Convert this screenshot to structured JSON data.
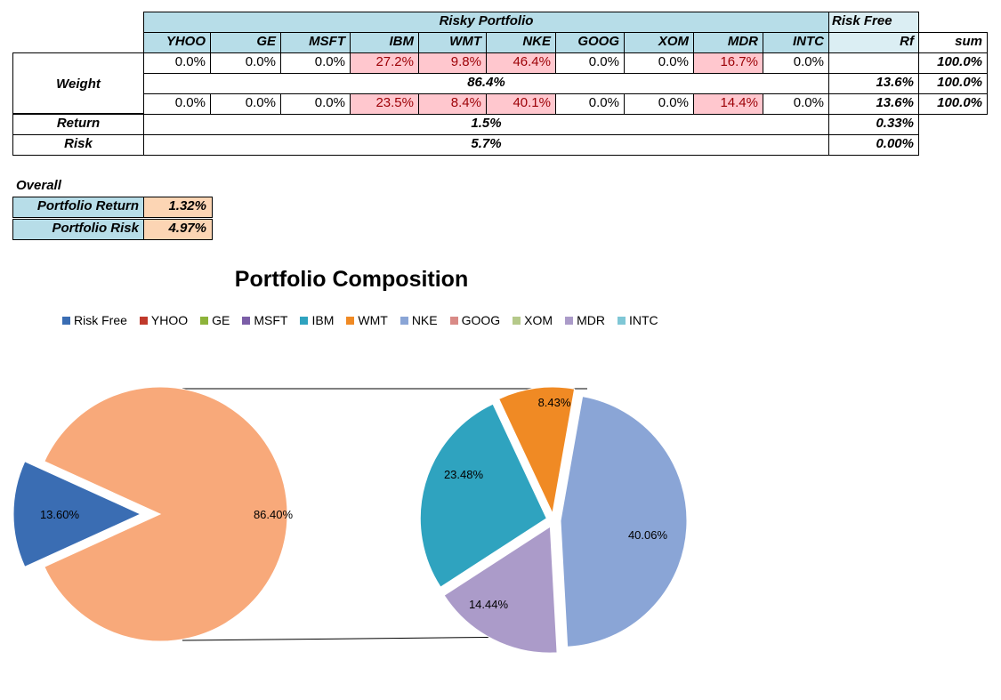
{
  "table": {
    "risky_header": "Risky Portfolio",
    "riskfree_header": "Risk Free",
    "columns": [
      "YHOO",
      "GE",
      "MSFT",
      "IBM",
      "WMT",
      "NKE",
      "GOOG",
      "XOM",
      "MDR",
      "INTC"
    ],
    "rf_col": "Rf",
    "sum_col": "sum",
    "weight_label": "Weight",
    "row1": [
      "0.0%",
      "0.0%",
      "0.0%",
      "27.2%",
      "9.8%",
      "46.4%",
      "0.0%",
      "0.0%",
      "16.7%",
      "0.0%"
    ],
    "row1_sum": "100.0%",
    "row2_risky": "86.4%",
    "row2_rf": "13.6%",
    "row2_sum": "100.0%",
    "row3": [
      "0.0%",
      "0.0%",
      "0.0%",
      "23.5%",
      "8.4%",
      "40.1%",
      "0.0%",
      "0.0%",
      "14.4%",
      "0.0%"
    ],
    "row3_rf": "13.6%",
    "row3_sum": "100.0%",
    "return_label": "Return",
    "return_risky": "1.5%",
    "return_rf": "0.33%",
    "risk_label": "Risk",
    "risk_risky": "5.7%",
    "risk_rf": "0.00%"
  },
  "overall": {
    "title": "Overall",
    "return_label": "Portfolio Return",
    "return_value": "1.32%",
    "risk_label": "Portfolio Risk",
    "risk_value": "4.97%"
  },
  "chart_data": {
    "type": "pie",
    "title": "Portfolio Composition",
    "legend_position": "top",
    "legend": [
      {
        "name": "Risk Free",
        "color": "#3a6db3"
      },
      {
        "name": "YHOO",
        "color": "#c0392b"
      },
      {
        "name": "GE",
        "color": "#8db33a"
      },
      {
        "name": "MSFT",
        "color": "#7b5ea7"
      },
      {
        "name": "IBM",
        "color": "#2fa3bf"
      },
      {
        "name": "WMT",
        "color": "#f08a24"
      },
      {
        "name": "NKE",
        "color": "#8aa5d6"
      },
      {
        "name": "GOOG",
        "color": "#d98a86"
      },
      {
        "name": "XOM",
        "color": "#b5c98a"
      },
      {
        "name": "MDR",
        "color": "#ab9bc9"
      },
      {
        "name": "INTC",
        "color": "#7fc7d6"
      }
    ],
    "main_pie": [
      {
        "name": "Risk Free",
        "value": 13.6,
        "label": "13.60%",
        "color": "#3a6db3"
      },
      {
        "name": "Risky Portfolio",
        "value": 86.4,
        "label": "86.40%",
        "color": "#f8a97a"
      }
    ],
    "sub_pie": [
      {
        "name": "NKE",
        "value": 40.06,
        "label": "40.06%",
        "color": "#8aa5d6"
      },
      {
        "name": "MDR",
        "value": 14.44,
        "label": "14.44%",
        "color": "#ab9bc9"
      },
      {
        "name": "IBM",
        "value": 23.48,
        "label": "23.48%",
        "color": "#2fa3bf"
      },
      {
        "name": "WMT",
        "value": 8.43,
        "label": "8.43%",
        "color": "#f08a24"
      }
    ]
  }
}
